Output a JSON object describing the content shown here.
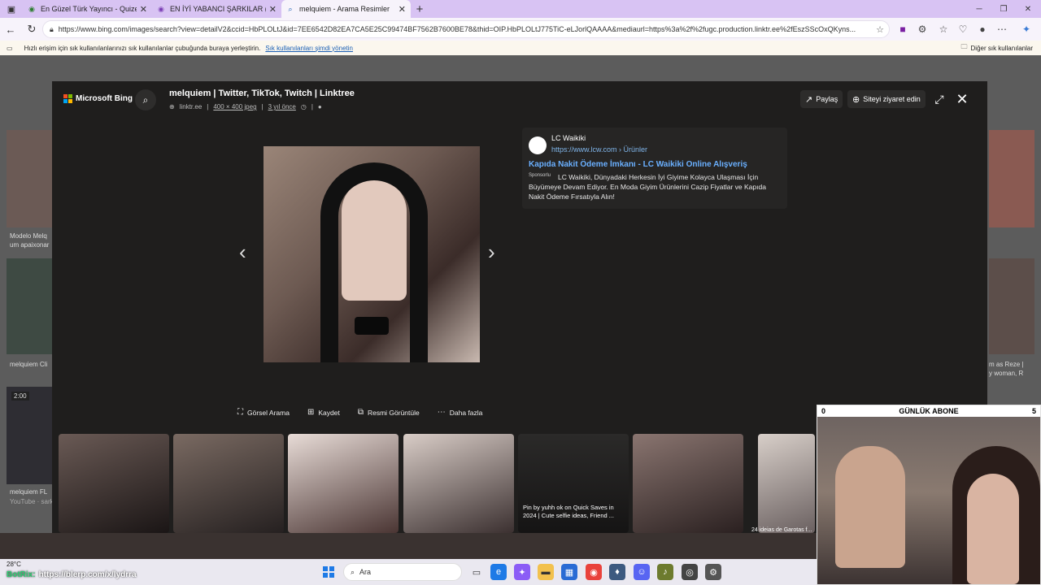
{
  "browser": {
    "tabs": [
      {
        "title": "En Güzel Türk Yayıncı - Quizei",
        "active": false
      },
      {
        "title": "EN İYİ YABANCI ŞARKILAR (ATAD...",
        "active": false
      },
      {
        "title": "melquiem - Arama Resimler",
        "active": true
      }
    ],
    "url": "https://www.bing.com/images/search?view=detailV2&ccid=HbPLOLtJ&id=7EE6542D82EA7CA5E25C99474BF7562B7600BE78&thid=OIP.HbPLOLtJ775TiC-eLJorlQAAAA&mediaurl=https%3a%2f%2fugc.production.linktr.ee%2fEszSScOxQKyns...",
    "favbar_hint": "Hızlı erişim için sık kullanılanlarınızı sık kullanılanlar çubuğunda buraya yerleştirin.",
    "favbar_manage": "Sık kullanılanları şimdi yönetin",
    "favbar_other": "Diğer sık kullanılanlar"
  },
  "background": {
    "captions": [
      "Modelo Melq",
      "um apaixonar",
      "melquiem Cli",
      "melquiem FL",
      "YouTube · sarki",
      "2:00",
      "m as Reze |",
      "y woman, R"
    ]
  },
  "modal": {
    "logo": "Microsoft Bing",
    "title": "melquiem | Twitter, TikTok, Twitch | Linktree",
    "meta": {
      "source": "linktr.ee",
      "size": "400 × 400 jpeg",
      "age": "3 yıl önce"
    },
    "share_label": "Paylaş",
    "visit_label": "Siteyi ziyaret edin",
    "ad": {
      "name": "LC Waikiki",
      "url": "https://www.lcw.com › Ürünler",
      "headline": "Kapıda Nakit Ödeme İmkanı - LC Waikiki Online Alışveriş",
      "sponsored": "Sponsorlu",
      "description": "LC Waikiki, Dünyadaki Herkesin İyi Giyime Kolayca Ulaşması İçin Büyümeye Devam Ediyor. En Moda Giyim Ürünlerini Cazip Fiyatlar ve Kapıda Nakit Ödeme Fırsatıyla Alın!"
    },
    "actions": [
      "Görsel Arama",
      "Kaydet",
      "Resmi Görüntüle",
      "Daha fazla"
    ],
    "thumb_caption": "Pin by yuhh ok on Quick Saves in 2024 | Cute selfie ideas, Friend ...",
    "thumb_caption2": "24 ideias de Garotas f..."
  },
  "taskbar": {
    "temp": "28°C",
    "search": "Ara",
    "botrix_name": "BotRix:",
    "botrix_msg": "https://blerp.com/x/lydrra"
  },
  "overlay": {
    "left": "0",
    "title": "GÜNLÜK ABONE",
    "right": "5"
  },
  "colors": {
    "accent": "#6ab0ff",
    "tabbar": "#d8c3f3",
    "modal": "#1f1e1d"
  }
}
